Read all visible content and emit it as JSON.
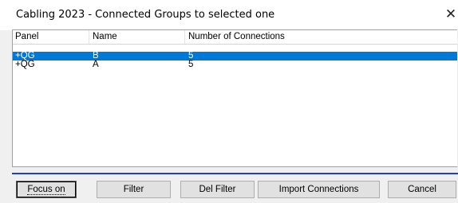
{
  "window": {
    "title": "Cabling 2023 - Connected Groups to selected one",
    "close_glyph": "✕"
  },
  "list": {
    "columns": [
      "Panel",
      "Name",
      "Number of Connections"
    ],
    "rows": [
      {
        "panel": "+QG",
        "name": "B",
        "connections": "5",
        "selected": true
      },
      {
        "panel": "+QG",
        "name": "A",
        "connections": "5",
        "selected": false
      }
    ]
  },
  "buttons": {
    "focus_on": "Focus on",
    "filter": "Filter",
    "del_filter": "Del Filter",
    "import_connections": "Import Connections",
    "cancel": "Cancel"
  },
  "colors": {
    "selection": "#0078d7",
    "divider": "#1a3fd1"
  }
}
